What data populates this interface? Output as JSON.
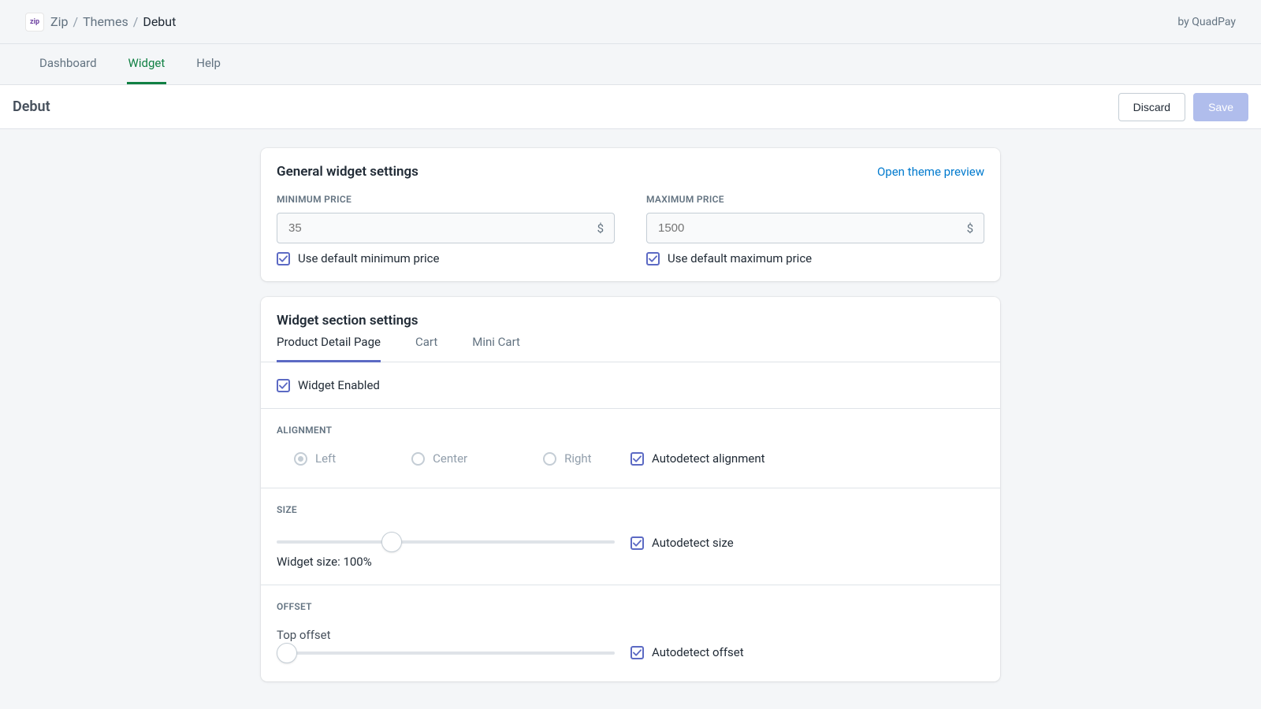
{
  "breadcrumb": {
    "app": "Zip",
    "parent": "Themes",
    "current": "Debut"
  },
  "credit": "by QuadPay",
  "nav": {
    "tabs": [
      "Dashboard",
      "Widget",
      "Help"
    ],
    "active": 1
  },
  "page": {
    "title": "Debut",
    "discard": "Discard",
    "save": "Save"
  },
  "general": {
    "title": "General widget settings",
    "preview_link": "Open theme preview",
    "min_label": "MINIMUM PRICE",
    "min_placeholder": "35",
    "min_suffix": "$",
    "min_default_label": "Use default minimum price",
    "max_label": "MAXIMUM PRICE",
    "max_placeholder": "1500",
    "max_suffix": "$",
    "max_default_label": "Use default maximum price"
  },
  "sections": {
    "title": "Widget section settings",
    "tabs": [
      "Product Detail Page",
      "Cart",
      "Mini Cart"
    ],
    "active": 0,
    "enabled_label": "Widget Enabled",
    "alignment": {
      "title": "ALIGNMENT",
      "options": [
        "Left",
        "Center",
        "Right"
      ],
      "auto_label": "Autodetect alignment"
    },
    "size": {
      "title": "SIZE",
      "value_label": "Widget size: 100%",
      "auto_label": "Autodetect size"
    },
    "offset": {
      "title": "OFFSET",
      "top_label": "Top offset",
      "auto_label": "Autodetect offset"
    }
  }
}
